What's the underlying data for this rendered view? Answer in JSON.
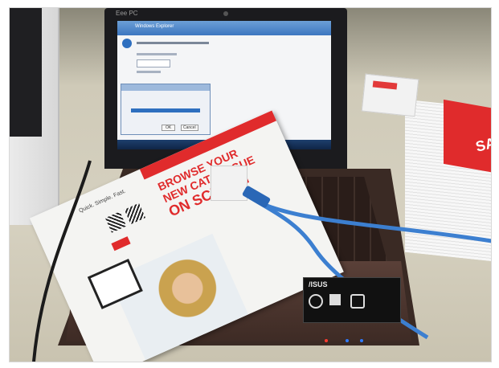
{
  "photo": {
    "laptop": {
      "brand_top": "Eee PC",
      "brand_bottom": "/ISUS",
      "screen_window_title": "Windows Explorer",
      "dialog_button_ok": "OK",
      "dialog_button_cancel": "Cancel"
    },
    "brochure": {
      "headline_line1": "BROWSE YOUR",
      "headline_line2": "NEW CATALOGUE",
      "headline_line3": "ON SCREEN",
      "side_label": "Quick. Simple. Fast."
    },
    "right_stack": {
      "sticker_text": "SA"
    }
  },
  "colors": {
    "screen_blue": "#2e6fbf",
    "screen_white": "#f4f5f7",
    "laptop_brown": "#3a2a24",
    "brochure_red": "#e02b2c",
    "cable_blue": "#3c7fd0",
    "table": "#d9d4c3"
  }
}
